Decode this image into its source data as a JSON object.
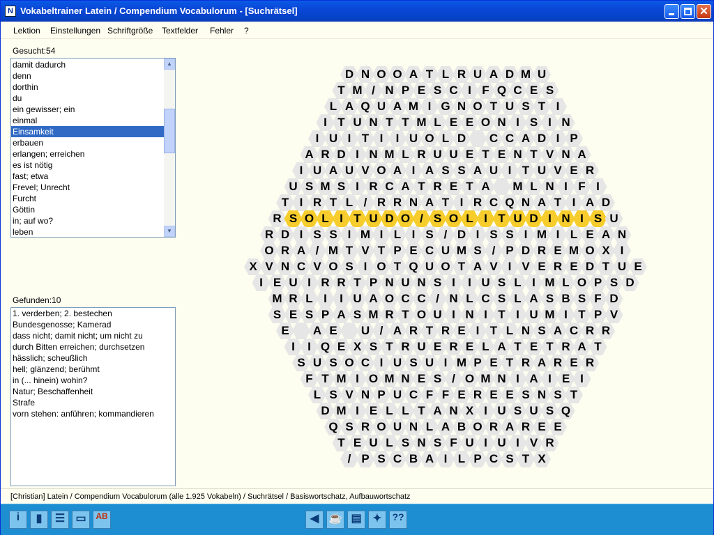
{
  "window": {
    "title": "Vokabeltrainer Latein / Compendium Vocabulorum - [Suchrätsel]",
    "app_icon": "app-icon"
  },
  "menu": [
    {
      "label": "Lektion",
      "u": "L"
    },
    {
      "label": "Einstellungen",
      "u": "E"
    },
    {
      "label": "Schriftgröße",
      "u": "S"
    },
    {
      "label": "Textfelder",
      "u": "T"
    },
    {
      "label": "Fehler",
      "u": "F"
    },
    {
      "label": "?",
      "u": "?"
    }
  ],
  "searched": {
    "label": "Gesucht:54",
    "items": [
      "damit dadurch",
      "denn",
      "dorthin",
      "du",
      "ein gewisser; ein",
      "einmal",
      "Einsamkeit",
      "erbauen",
      "erlangen; erreichen",
      "es ist nötig",
      "fast; etwa",
      "Frevel; Unrecht",
      "Furcht",
      "Göttin",
      "in; auf wo?",
      "leben"
    ],
    "selected_index": 6
  },
  "found": {
    "label": "Gefunden:10",
    "items": [
      "1. verderben; 2. bestechen",
      "Bundesgenosse; Kamerad",
      "dass nicht; damit nicht; um nicht zu",
      "durch Bitten erreichen; durchsetzen",
      "hässlich; scheußlich",
      "hell; glänzend; berühmt",
      "in (... hinein) wohin?",
      "Natur; Beschaffenheit",
      "Strafe",
      "vorn stehen: anführen; kommandieren"
    ]
  },
  "puzzle": {
    "rows": [
      "DNOOATLRUADMU",
      "TM/NPESCIFQCES",
      "LAQUAMIGNOTUSTI",
      "ITUNTTMLEEONISIN",
      "IUITIIUOLD CCADIP",
      "ARDINMLRUUETENTVNA",
      "IUAUVOAIASSAUITUVER",
      "USMSIRCATRETA MLNIFI",
      "TIRTL/RRNATIRCQNATIAD",
      "RSOLITUDO/SOLITUDINISU",
      "RDISSIMILIS/DISSIMILEAN",
      "ORA/MTVTPECUMS/PDREMOXI",
      "XVNCVOSIOTQUOTAVIVEREDTUE",
      "IEUIRRTPNUNSIIUSLIMLOPSD",
      "MRLIIUAOCC/NLCSLASBSFD",
      "SESPASMRTOUINITIUMITPV",
      "E AE U/ARTREITLNSACRR",
      "IIQEXSTRUERELATETRAT",
      "SUSOCIUSUIMPETRARER",
      "FTMIOMNES/OMNIAIEI",
      "LSVNPUCFFEREESNST",
      "DMIELLTANXIUSUSQ",
      "QSROUNLABORAREE",
      "TEULSNSFUIUIVR",
      "/PSCBAILPCSTX"
    ],
    "highlight": {
      "row": 9,
      "from": 1,
      "to": 20,
      "word": "SOLITUDO/SOLITUDINIS",
      "color": "#f6cd2c"
    }
  },
  "status": "[Christian]  Latein / Compendium Vocabulorum  (alle 1.925 Vokabeln) / Suchrätsel / Basiswortschatz, Aufbauwortschatz",
  "toolbar": {
    "left": [
      "info-icon",
      "book-icon",
      "list-icon",
      "card-icon",
      "ab-icon"
    ],
    "center": [
      "back-icon",
      "coffee-icon",
      "print-icon",
      "lightbulb-icon",
      "help-icon"
    ]
  }
}
